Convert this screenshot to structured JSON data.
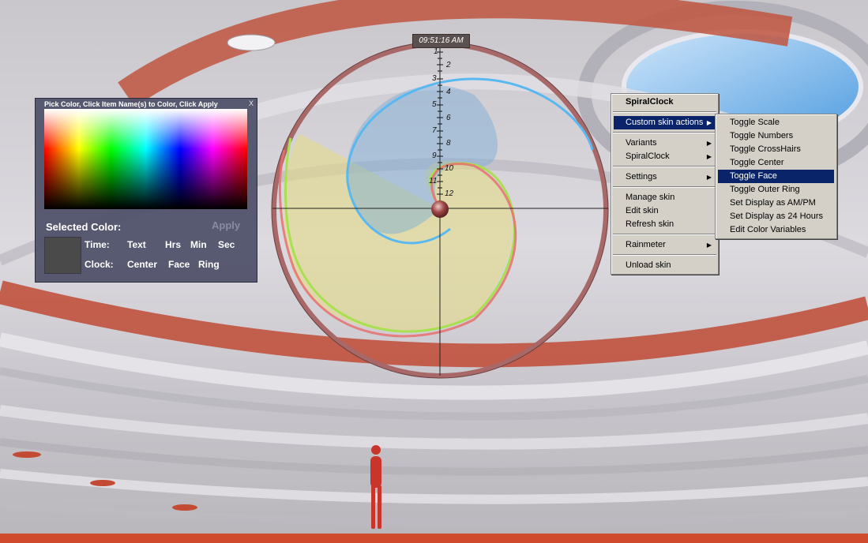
{
  "clock": {
    "time": "09:51:16 AM",
    "scale_numbers": [
      "1",
      "2",
      "3",
      "4",
      "5",
      "6",
      "7",
      "8",
      "9",
      "10",
      "11",
      "12"
    ]
  },
  "picker": {
    "title": "Pick Color, Click Item Name(s) to Color, Click Apply",
    "close": "X",
    "selected_color_label": "Selected Color:",
    "apply_label": "Apply",
    "time_label": "Time:",
    "time_items": [
      "Text",
      "Hrs",
      "Min",
      "Sec"
    ],
    "clock_label": "Clock:",
    "clock_items": [
      "Center",
      "Face",
      "Ring"
    ]
  },
  "context_menu": {
    "title": "SpiralClock",
    "items": [
      {
        "label": "Custom skin actions",
        "submenu": true
      },
      {
        "label": "Variants",
        "submenu": true
      },
      {
        "label": "SpiralClock",
        "submenu": true
      },
      {
        "label": "Settings",
        "submenu": true
      },
      {
        "label": "Manage skin"
      },
      {
        "label": "Edit skin"
      },
      {
        "label": "Refresh skin"
      },
      {
        "label": "Rainmeter",
        "submenu": true
      },
      {
        "label": "Unload skin"
      }
    ]
  },
  "submenu": {
    "items": [
      "Toggle Scale",
      "Toggle Numbers",
      "Toggle CrossHairs",
      "Toggle Center",
      "Toggle Face",
      "Toggle Outer Ring",
      "Set Display as AM/PM",
      "Set Display as 24 Hours",
      "Edit Color Variables"
    ],
    "highlighted": "Toggle Face"
  },
  "colors": {
    "menu_highlight": "#0a246a",
    "menu_bg": "#d4d0c8",
    "ring": "#a86868",
    "spiral_hours": "#5ab8f0",
    "spiral_minutes": "#a8e050",
    "spiral_seconds": "#e87070"
  }
}
